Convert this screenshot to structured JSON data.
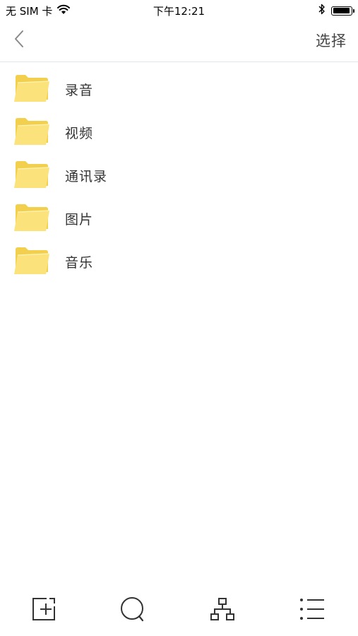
{
  "status_bar": {
    "carrier": "无 SIM 卡",
    "time": "下午12:21",
    "battery_level": 0.95
  },
  "nav": {
    "back_icon": "chevron-left-icon",
    "select_label": "选择"
  },
  "folders": [
    {
      "label": "录音",
      "icon": "folder-icon"
    },
    {
      "label": "视频",
      "icon": "folder-icon"
    },
    {
      "label": "通讯录",
      "icon": "folder-icon"
    },
    {
      "label": "图片",
      "icon": "folder-icon"
    },
    {
      "label": "音乐",
      "icon": "folder-icon"
    }
  ],
  "toolbar": {
    "items": [
      {
        "icon": "new-folder-icon"
      },
      {
        "icon": "search-icon"
      },
      {
        "icon": "hierarchy-icon"
      },
      {
        "icon": "list-icon"
      }
    ]
  },
  "colors": {
    "folder_back": "#f3cf4e",
    "folder_front": "#fbe27a",
    "divider": "#dfe6ee"
  }
}
